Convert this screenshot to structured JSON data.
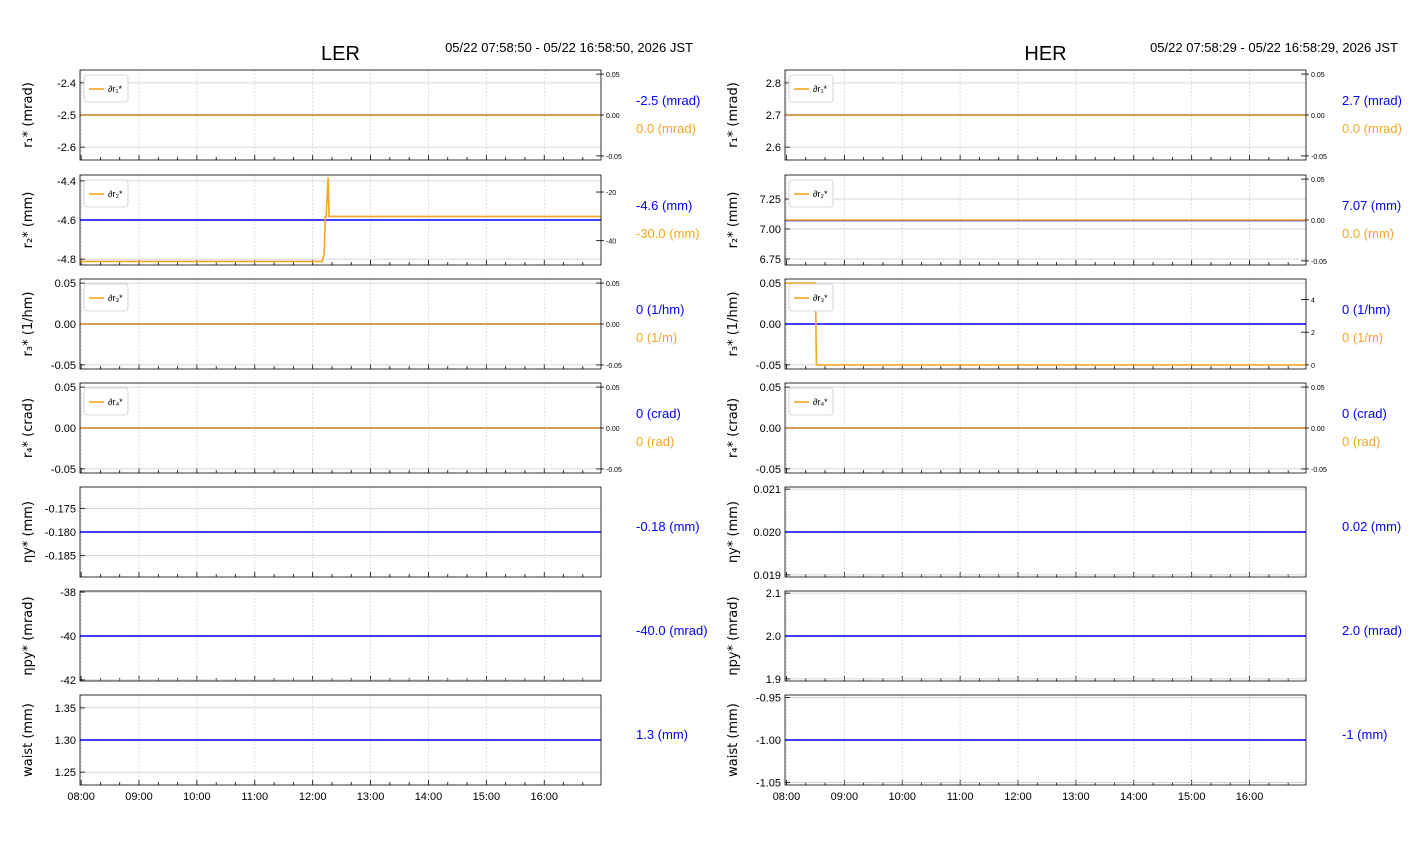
{
  "colors": {
    "primary": "#0000ff",
    "delta": "#f5a623",
    "grid": "#c8c8c8",
    "frame": "#000000"
  },
  "x_ticks": [
    "08:00",
    "09:00",
    "10:00",
    "11:00",
    "12:00",
    "13:00",
    "14:00",
    "15:00",
    "16:00"
  ],
  "chart_data": [
    {
      "type": "line",
      "title": "LER",
      "time_range": "05/22 07:58:50 - 05/22 16:58:50, 2026 JST",
      "xlim": [
        "07:58:50",
        "16:58:50"
      ],
      "grid": true,
      "legend_position": "top-left",
      "panels": [
        {
          "ylabel": "r₁* (mrad)",
          "ylim": [
            -2.64,
            -2.36
          ],
          "yticks": [
            "-2.4",
            "-2.5",
            "-2.6"
          ],
          "ytick_values": [
            -2.4,
            -2.5,
            -2.6
          ],
          "right_ylim": [
            -0.055,
            0.055
          ],
          "right_yticks": [
            "0.05",
            "0.00",
            "-0.05"
          ],
          "right_ytick_values": [
            0.05,
            0.0,
            -0.05
          ],
          "legend": "∂r₁*",
          "series": [
            {
              "axis": "left",
              "color": "primary",
              "points": [
                [
                  "07:58:50",
                  -2.5
                ],
                [
                  "16:58:50",
                  -2.5
                ]
              ]
            },
            {
              "axis": "right",
              "color": "delta",
              "points": [
                [
                  "07:58:50",
                  0.0
                ],
                [
                  "16:58:50",
                  0.0
                ]
              ]
            }
          ],
          "current_value": "-2.5 (mrad)",
          "current_delta": "0.0 (mrad)"
        },
        {
          "ylabel": "r₂* (mm)",
          "ylim": [
            -4.83,
            -4.37
          ],
          "yticks": [
            "-4.4",
            "-4.6",
            "-4.8"
          ],
          "ytick_values": [
            -4.4,
            -4.6,
            -4.8
          ],
          "right_ylim": [
            -50,
            -13
          ],
          "right_yticks": [
            "-20",
            "-40"
          ],
          "right_ytick_values": [
            -20,
            -40
          ],
          "legend": "∂r₂*",
          "series": [
            {
              "axis": "left",
              "color": "primary",
              "points": [
                [
                  "07:58:50",
                  -4.6
                ],
                [
                  "16:58:50",
                  -4.6
                ]
              ]
            },
            {
              "axis": "right",
              "color": "delta",
              "points": [
                [
                  "07:58:50",
                  -48.5
                ],
                [
                  "12:10",
                  -48.5
                ],
                [
                  "12:12",
                  -45
                ],
                [
                  "12:13",
                  -30
                ],
                [
                  "12:14",
                  -30
                ],
                [
                  "12:16",
                  -14
                ],
                [
                  "12:17",
                  -30
                ],
                [
                  "16:58:50",
                  -30
                ]
              ]
            }
          ],
          "current_value": "-4.6 (mm)",
          "current_delta": "-30.0 (mm)"
        },
        {
          "ylabel": "r₃* (1/hm)",
          "ylim": [
            -0.055,
            0.055
          ],
          "yticks": [
            "0.05",
            "0.00",
            "-0.05"
          ],
          "ytick_values": [
            0.05,
            0.0,
            -0.05
          ],
          "right_ylim": [
            -0.055,
            0.055
          ],
          "right_yticks": [
            "0.05",
            "0.00",
            "-0.05"
          ],
          "right_ytick_values": [
            0.05,
            0.0,
            -0.05
          ],
          "legend": "∂r₃*",
          "series": [
            {
              "axis": "left",
              "color": "primary",
              "points": [
                [
                  "07:58:50",
                  0.0
                ],
                [
                  "16:58:50",
                  0.0
                ]
              ]
            },
            {
              "axis": "right",
              "color": "delta",
              "points": [
                [
                  "07:58:50",
                  0.0
                ],
                [
                  "16:58:50",
                  0.0
                ]
              ]
            }
          ],
          "current_value": "0 (1/hm)",
          "current_delta": "0 (1/m)"
        },
        {
          "ylabel": "r₄* (crad)",
          "ylim": [
            -0.055,
            0.055
          ],
          "yticks": [
            "0.05",
            "0.00",
            "-0.05"
          ],
          "ytick_values": [
            0.05,
            0.0,
            -0.05
          ],
          "right_ylim": [
            -0.055,
            0.055
          ],
          "right_yticks": [
            "0.05",
            "0.00",
            "-0.05"
          ],
          "right_ytick_values": [
            0.05,
            0.0,
            -0.05
          ],
          "legend": "∂r₄*",
          "series": [
            {
              "axis": "left",
              "color": "primary",
              "points": [
                [
                  "07:58:50",
                  0.0
                ],
                [
                  "16:58:50",
                  0.0
                ]
              ]
            },
            {
              "axis": "right",
              "color": "delta",
              "points": [
                [
                  "07:58:50",
                  0.0
                ],
                [
                  "16:58:50",
                  0.0
                ]
              ]
            }
          ],
          "current_value": "0 (crad)",
          "current_delta": "0 (rad)"
        },
        {
          "ylabel": "ηy* (mm)",
          "ylim": [
            -0.1895,
            -0.1705
          ],
          "yticks": [
            "-0.175",
            "-0.180",
            "-0.185"
          ],
          "ytick_values": [
            -0.175,
            -0.18,
            -0.185
          ],
          "series": [
            {
              "axis": "left",
              "color": "primary",
              "points": [
                [
                  "07:58:50",
                  -0.18
                ],
                [
                  "16:58:50",
                  -0.18
                ]
              ]
            }
          ],
          "current_value": "-0.18 (mm)"
        },
        {
          "ylabel": "ηpy* (mrad)",
          "ylim": [
            -42.05,
            -37.95
          ],
          "yticks": [
            "-38",
            "-40",
            "-42"
          ],
          "ytick_values": [
            -38,
            -40,
            -42
          ],
          "series": [
            {
              "axis": "left",
              "color": "primary",
              "points": [
                [
                  "07:58:50",
                  -40.0
                ],
                [
                  "16:58:50",
                  -40.0
                ]
              ]
            }
          ],
          "current_value": "-40.0 (mrad)"
        },
        {
          "ylabel": "waist (mm)",
          "ylim": [
            1.23,
            1.37
          ],
          "yticks": [
            "1.35",
            "1.30",
            "1.25"
          ],
          "ytick_values": [
            1.35,
            1.3,
            1.25
          ],
          "series": [
            {
              "axis": "left",
              "color": "primary",
              "points": [
                [
                  "07:58:50",
                  1.3
                ],
                [
                  "16:58:50",
                  1.3
                ]
              ]
            }
          ],
          "current_value": "1.3 (mm)"
        }
      ]
    },
    {
      "type": "line",
      "title": "HER",
      "time_range": "05/22 07:58:29 - 05/22 16:58:29, 2026 JST",
      "xlim": [
        "07:58:29",
        "16:58:29"
      ],
      "grid": true,
      "legend_position": "top-left",
      "panels": [
        {
          "ylabel": "r₁* (mrad)",
          "ylim": [
            2.56,
            2.84
          ],
          "yticks": [
            "2.8",
            "2.7",
            "2.6"
          ],
          "ytick_values": [
            2.8,
            2.7,
            2.6
          ],
          "right_ylim": [
            -0.055,
            0.055
          ],
          "right_yticks": [
            "0.05",
            "0.00",
            "-0.05"
          ],
          "right_ytick_values": [
            0.05,
            0.0,
            -0.05
          ],
          "legend": "∂r₁*",
          "series": [
            {
              "axis": "left",
              "color": "primary",
              "points": [
                [
                  "07:58:29",
                  2.7
                ],
                [
                  "16:58:29",
                  2.7
                ]
              ]
            },
            {
              "axis": "right",
              "color": "delta",
              "points": [
                [
                  "07:58:29",
                  0.0
                ],
                [
                  "16:58:29",
                  0.0
                ]
              ]
            }
          ],
          "current_value": "2.7 (mrad)",
          "current_delta": "0.0 (mrad)"
        },
        {
          "ylabel": "r₂* (mm)",
          "ylim": [
            6.7,
            7.45
          ],
          "yticks": [
            "7.25",
            "7.00",
            "6.75"
          ],
          "ytick_values": [
            7.25,
            7.0,
            6.75
          ],
          "right_ylim": [
            -0.055,
            0.055
          ],
          "right_yticks": [
            "0.05",
            "0.00",
            "-0.05"
          ],
          "right_ytick_values": [
            0.05,
            0.0,
            -0.05
          ],
          "legend": "∂r₂*",
          "series": [
            {
              "axis": "left",
              "color": "primary",
              "points": [
                [
                  "07:58:29",
                  7.07
                ],
                [
                  "16:58:29",
                  7.07
                ]
              ]
            },
            {
              "axis": "right",
              "color": "delta",
              "points": [
                [
                  "07:58:29",
                  0.0
                ],
                [
                  "16:58:29",
                  0.0
                ]
              ]
            }
          ],
          "current_value": "7.07 (mm)",
          "current_delta": "0.0 (mm)"
        },
        {
          "ylabel": "r₃* (1/hm)",
          "ylim": [
            -0.055,
            0.055
          ],
          "yticks": [
            "0.05",
            "0.00",
            "-0.05"
          ],
          "ytick_values": [
            0.05,
            0.0,
            -0.05
          ],
          "right_ylim": [
            -0.25,
            5.25
          ],
          "right_yticks": [
            "4",
            "2",
            "0"
          ],
          "right_ytick_values": [
            4,
            2,
            0
          ],
          "legend": "∂r₃*",
          "series": [
            {
              "axis": "left",
              "color": "primary",
              "points": [
                [
                  "07:58:29",
                  0.0
                ],
                [
                  "16:58:29",
                  0.0
                ]
              ]
            },
            {
              "axis": "right",
              "color": "delta",
              "points": [
                [
                  "07:58:29",
                  5.0
                ],
                [
                  "08:30",
                  5.0
                ],
                [
                  "08:31",
                  0.0
                ],
                [
                  "16:58:29",
                  0.0
                ]
              ]
            }
          ],
          "current_value": "0 (1/hm)",
          "current_delta": "0 (1/m)"
        },
        {
          "ylabel": "r₄* (crad)",
          "ylim": [
            -0.055,
            0.055
          ],
          "yticks": [
            "0.05",
            "0.00",
            "-0.05"
          ],
          "ytick_values": [
            0.05,
            0.0,
            -0.05
          ],
          "right_ylim": [
            -0.055,
            0.055
          ],
          "right_yticks": [
            "0.05",
            "0.00",
            "-0.05"
          ],
          "right_ytick_values": [
            0.05,
            0.0,
            -0.05
          ],
          "legend": "∂r₄*",
          "series": [
            {
              "axis": "left",
              "color": "primary",
              "points": [
                [
                  "07:58:29",
                  0.0
                ],
                [
                  "16:58:29",
                  0.0
                ]
              ]
            },
            {
              "axis": "right",
              "color": "delta",
              "points": [
                [
                  "07:58:29",
                  0.0
                ],
                [
                  "16:58:29",
                  0.0
                ]
              ]
            }
          ],
          "current_value": "0 (crad)",
          "current_delta": "0 (rad)"
        },
        {
          "ylabel": "ηy* (mm)",
          "ylim": [
            0.01895,
            0.02105
          ],
          "yticks": [
            "0.021",
            "0.020",
            "0.019"
          ],
          "ytick_values": [
            0.021,
            0.02,
            0.019
          ],
          "series": [
            {
              "axis": "left",
              "color": "primary",
              "points": [
                [
                  "07:58:29",
                  0.02
                ],
                [
                  "16:58:29",
                  0.02
                ]
              ]
            }
          ],
          "current_value": "0.02 (mm)"
        },
        {
          "ylabel": "ηpy* (mrad)",
          "ylim": [
            1.895,
            2.105
          ],
          "yticks": [
            "2.1",
            "2.0",
            "1.9"
          ],
          "ytick_values": [
            2.1,
            2.0,
            1.9
          ],
          "series": [
            {
              "axis": "left",
              "color": "primary",
              "points": [
                [
                  "07:58:29",
                  2.0
                ],
                [
                  "16:58:29",
                  2.0
                ]
              ]
            }
          ],
          "current_value": "2.0 (mrad)"
        },
        {
          "ylabel": "waist (mm)",
          "ylim": [
            -1.053,
            -0.947
          ],
          "yticks": [
            "-0.95",
            "-1.00",
            "-1.05"
          ],
          "ytick_values": [
            -0.95,
            -1.0,
            -1.05
          ],
          "series": [
            {
              "axis": "left",
              "color": "primary",
              "points": [
                [
                  "07:58:29",
                  -1.0
                ],
                [
                  "16:58:29",
                  -1.0
                ]
              ]
            }
          ],
          "current_value": "-1 (mm)"
        }
      ]
    }
  ]
}
